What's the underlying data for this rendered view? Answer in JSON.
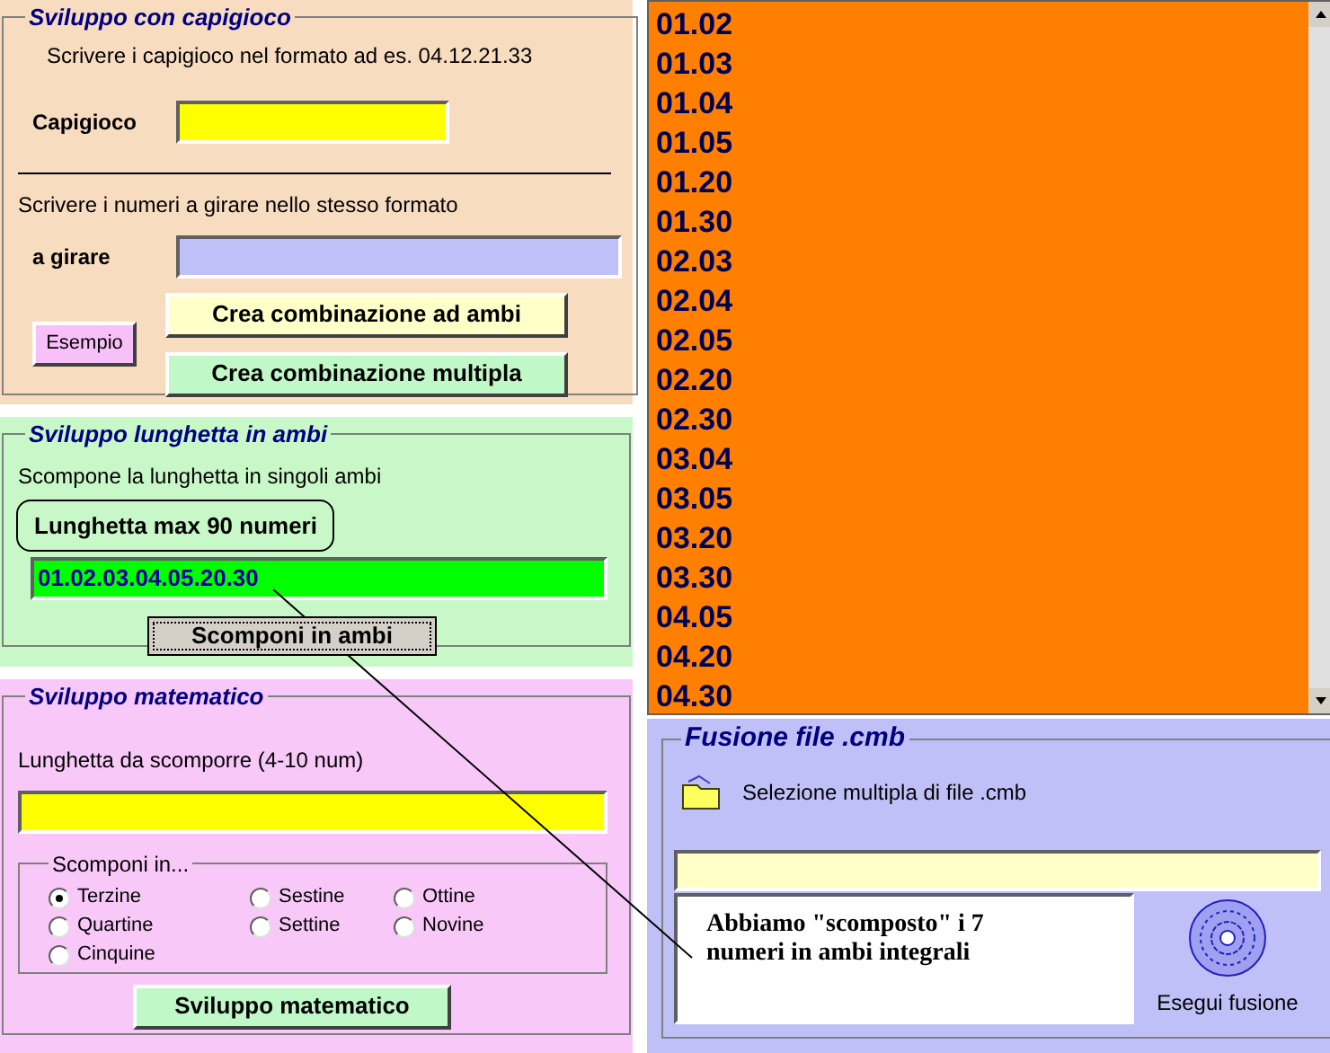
{
  "capigioco_panel": {
    "title": "Sviluppo con capigioco",
    "instruction": "Scrivere i capigioco nel formato ad es. 04.12.21.33",
    "capigioco_label": "Capigioco",
    "instruction_2": "Scrivere i numeri a girare nello stesso formato",
    "girare_label": "a girare",
    "example_button": "Esempio",
    "buttons": [
      "Crea combinazione ad ambi",
      "Crea combinazione multipla"
    ]
  },
  "lunghetta_panel": {
    "title": "Sviluppo lunghetta in ambi",
    "description": "Scompone la lunghetta in singoli ambi",
    "field_label": "Lunghetta max 90 numeri",
    "field_value": "01.02.03.04.05.20.30",
    "button": "Scomponi in ambi"
  },
  "matematico_panel": {
    "title": "Sviluppo matematico",
    "field_label": "Lunghetta da scomporre (4-10 num)",
    "group_title": "Scomponi in...",
    "options": [
      {
        "label": "Terzine",
        "selected": true
      },
      {
        "label": "Quartine",
        "selected": false
      },
      {
        "label": "Cinquine",
        "selected": false
      },
      {
        "label": "Sestine",
        "selected": false
      },
      {
        "label": "Settine",
        "selected": false
      },
      {
        "label": "Ottine",
        "selected": false
      },
      {
        "label": "Novine",
        "selected": false
      }
    ],
    "button": "Sviluppo matematico"
  },
  "result_list": [
    "01.02",
    "01.03",
    "01.04",
    "01.05",
    "01.20",
    "01.30",
    "02.03",
    "02.04",
    "02.05",
    "02.20",
    "02.30",
    "03.04",
    "03.05",
    "03.20",
    "03.30",
    "04.05",
    "04.20",
    "04.30"
  ],
  "fusion_panel": {
    "title": "Fusione file .cmb",
    "select_label": "Selezione multipla di file .cmb",
    "note": "Abbiamo \"scomposto\" i 7 numeri in ambi integrali",
    "run_button": "Esegui fusione"
  }
}
